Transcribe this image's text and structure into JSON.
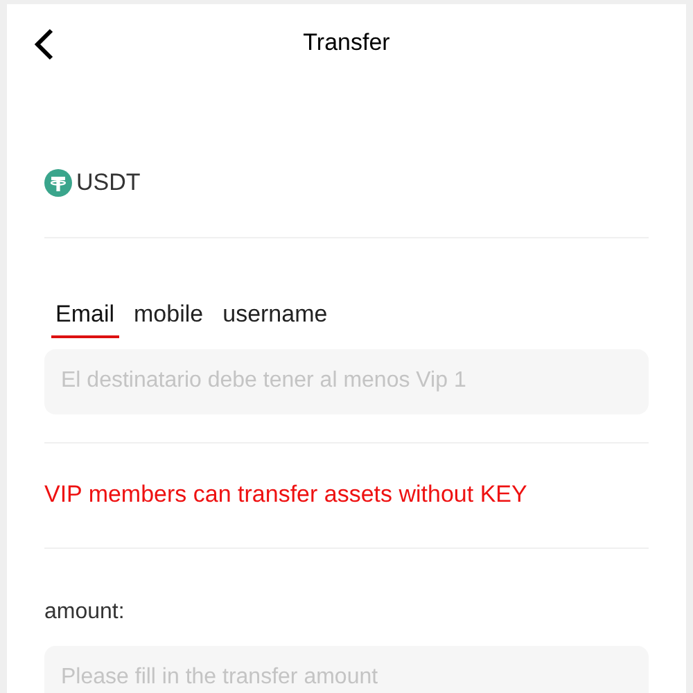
{
  "header": {
    "title": "Transfer"
  },
  "asset": {
    "label": "USDT"
  },
  "tabs": [
    {
      "label": "Email",
      "selected": true
    },
    {
      "label": "mobile",
      "selected": false
    },
    {
      "label": "username",
      "selected": false
    }
  ],
  "recipient": {
    "placeholder": "El destinatario debe tener al menos Vip 1"
  },
  "notice": "VIP members can transfer assets without KEY",
  "amount": {
    "label": "amount:",
    "placeholder": "Please fill in the transfer amount"
  }
}
